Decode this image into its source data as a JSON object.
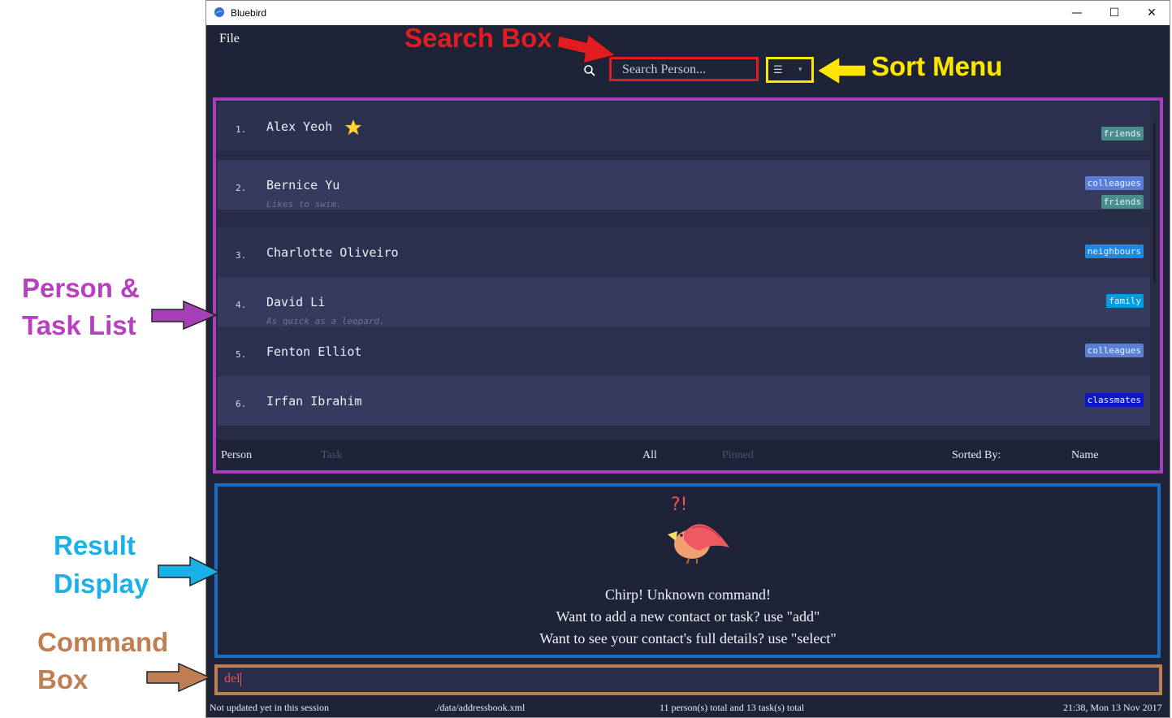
{
  "window": {
    "title": "Bluebird",
    "minimize": "—",
    "maximize": "☐",
    "close": "✕"
  },
  "menu": {
    "file": "File"
  },
  "search": {
    "placeholder": "Search Person..."
  },
  "sort": {
    "icon": "☰",
    "caret": "▾"
  },
  "persons": [
    {
      "index": "1.",
      "name": "Alex Yeoh",
      "pinned": true,
      "description": "",
      "tags": [
        {
          "label": "friends",
          "color": "#4a8d8a"
        }
      ]
    },
    {
      "index": "2.",
      "name": "Bernice Yu",
      "pinned": false,
      "description": "Likes to swim.",
      "tags": [
        {
          "label": "colleagues",
          "color": "#5b7fd8"
        },
        {
          "label": "friends",
          "color": "#4a8d8a"
        }
      ]
    },
    {
      "index": "3.",
      "name": "Charlotte Oliveiro",
      "pinned": false,
      "description": "",
      "tags": [
        {
          "label": "neighbours",
          "color": "#1e88e5"
        }
      ]
    },
    {
      "index": "4.",
      "name": "David Li",
      "pinned": false,
      "description": "As quick as a leopard.",
      "tags": [
        {
          "label": "family",
          "color": "#039be5"
        }
      ]
    },
    {
      "index": "5.",
      "name": "Fenton Elliot",
      "pinned": false,
      "description": "",
      "tags": [
        {
          "label": "colleagues",
          "color": "#5b7fd8"
        }
      ]
    },
    {
      "index": "6.",
      "name": "Irfan Ibrahim",
      "pinned": false,
      "description": "",
      "tags": [
        {
          "label": "classmates",
          "color": "#0d17c9"
        }
      ]
    }
  ],
  "list_footer": {
    "person": "Person",
    "task": "Task",
    "all": "All",
    "pinned": "Pinned",
    "sorted_by": "Sorted By:",
    "sort_field": "Name"
  },
  "result": {
    "bird_mark": "?!",
    "lines": [
      "Chirp! Unknown command!",
      "Want to add a new contact or task? use \"add\"",
      "Want to see your contact's full details? use \"select\""
    ]
  },
  "command": {
    "value": "del"
  },
  "status": {
    "sync": "Not updated yet in this session",
    "path": "./data/addressbook.xml",
    "totals": "11 person(s) total and 13 task(s) total",
    "time": "21:38, Mon 13 Nov 2017"
  },
  "annotations": {
    "search_box": "Search Box",
    "sort_menu": "Sort Menu",
    "list_line1": "Person &",
    "list_line2": "Task List",
    "result_line1": "Result",
    "result_line2": "Display",
    "command_line1": "Command",
    "command_line2": "Box"
  },
  "colors": {
    "search": "#e31b23",
    "sort": "#ffe600",
    "list": "#a63fb8",
    "result": "#1b6dbf",
    "command": "#bf7f53",
    "result_text": "#1ab0e8",
    "list_text": "#b83fbf"
  }
}
